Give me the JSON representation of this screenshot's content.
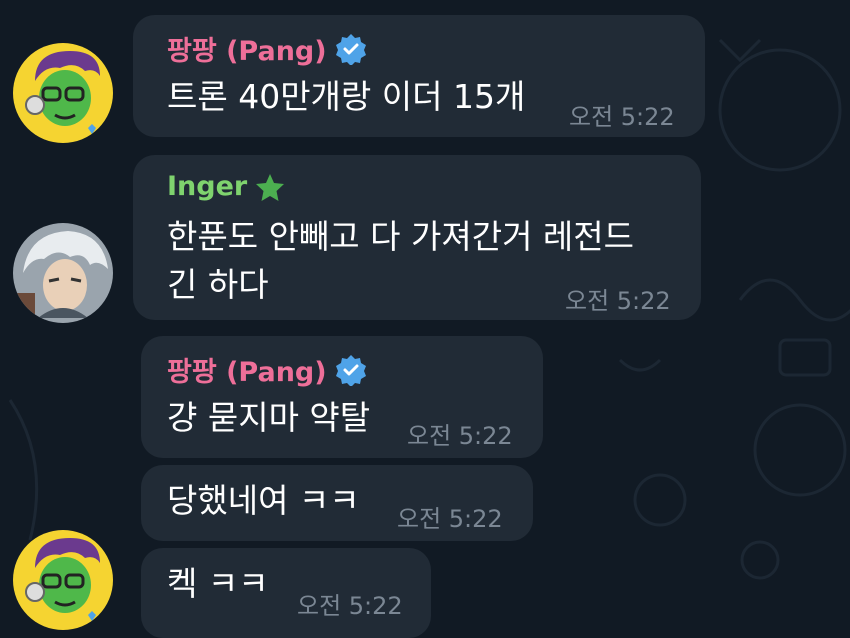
{
  "colors": {
    "background": "#111a24",
    "bubble": "#212b36",
    "pang_name": "#ee6f99",
    "inger_name": "#7fd36e",
    "verified_badge": "#4fa3e8",
    "timestamp": "#7b8794"
  },
  "messages": [
    {
      "sender": "팡팡 (Pang)",
      "badge_icon": "verified-badge-icon",
      "text": "트론 40만개랑 이더 15개",
      "time": "오전 5:22"
    },
    {
      "sender": "Inger",
      "badge_icon": "star-icon",
      "text_lines": [
        "한푼도 안빼고 다 가져간거 레전드",
        "긴 하다"
      ],
      "time": "오전 5:22"
    },
    {
      "sender": "팡팡 (Pang)",
      "badge_icon": "verified-badge-icon",
      "text": "걍 묻지마 약탈",
      "time": "오전 5:22"
    },
    {
      "text": "당했네여 ㅋㅋ",
      "time": "오전 5:22"
    },
    {
      "text": "켁 ㅋㅋ",
      "time": "오전 5:22"
    }
  ]
}
